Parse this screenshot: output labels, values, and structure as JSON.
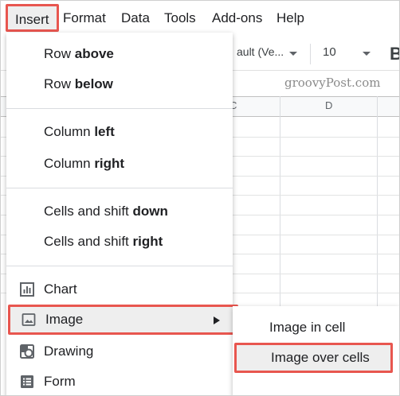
{
  "menubar": {
    "items": [
      "Insert",
      "Format",
      "Data",
      "Tools",
      "Add-ons",
      "Help"
    ]
  },
  "toolbar": {
    "font_name": "ault (Ve...",
    "font_size": "10",
    "bold_label": "B"
  },
  "watermark": "groovyPost.com",
  "columns": [
    "C",
    "D"
  ],
  "insert_menu": {
    "row_above": {
      "prefix": "Row ",
      "emph": "above"
    },
    "row_below": {
      "prefix": "Row ",
      "emph": "below"
    },
    "column_left": {
      "prefix": "Column ",
      "emph": "left"
    },
    "column_right": {
      "prefix": "Column ",
      "emph": "right"
    },
    "cells_shift_down": {
      "prefix": "Cells and shift ",
      "emph": "down"
    },
    "cells_shift_right": {
      "prefix": "Cells and shift ",
      "emph": "right"
    },
    "chart": "Chart",
    "image": "Image",
    "drawing": "Drawing",
    "form": "Form"
  },
  "image_submenu": {
    "in_cell": "Image in cell",
    "over_cells": "Image over cells"
  },
  "colors": {
    "highlight_border": "#e8564f",
    "highlight_bg": "#eeeeee"
  }
}
